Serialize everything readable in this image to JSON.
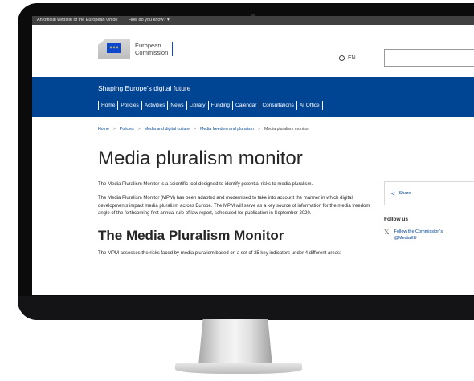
{
  "topbar": {
    "official_text": "An official website of the European Union",
    "how_text": "How do you know?"
  },
  "header": {
    "logo_line1": "European",
    "logo_line2": "Commission",
    "language": "EN"
  },
  "bluebar": {
    "site_title": "Shaping Europe's digital future",
    "nav": [
      "Home",
      "Policies",
      "Activities",
      "News",
      "Library",
      "Funding",
      "Calendar",
      "Consultations",
      "AI Office"
    ]
  },
  "breadcrumb": [
    "Home",
    "Policies",
    "Media and digital culture",
    "Media freedom and pluralism",
    "Media pluralism monitor"
  ],
  "main": {
    "title": "Media pluralism monitor",
    "lead": "The Media Pluralism Monitor is a scientific tool designed to identify potential risks to media pluralism.",
    "paragraph": "The Media Pluralism Monitor (MPM) has been adapted and modernised to take into account the manner in which digital developments impact media pluralism across Europe. The MPM will serve as a key source of information for the media freedom angle of the forthcoming first annual rule of law report, scheduled for publication in September 2020.",
    "subtitle": "The Media Pluralism Monitor",
    "paragraph2": "The MPM assesses the risks faced by media pluralism based on a set of 25 key indicators under 4 different areas:"
  },
  "sidebar": {
    "share": "Share",
    "follow_title": "Follow us",
    "follow_line1": "Follow the Commission's",
    "follow_line2": "@MediaEU"
  },
  "colors": {
    "brand_blue": "#004494",
    "flag_blue": "#0e47cb",
    "flag_yellow": "#ffd617"
  }
}
